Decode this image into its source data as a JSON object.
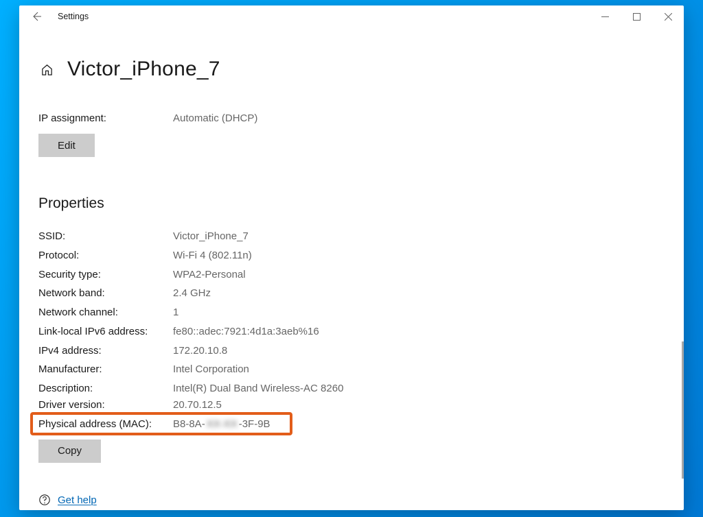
{
  "window": {
    "title": "Settings"
  },
  "header": {
    "page_title": "Victor_iPhone_7"
  },
  "ip_assignment": {
    "label": "IP assignment:",
    "value": "Automatic (DHCP)",
    "button": "Edit"
  },
  "properties": {
    "heading": "Properties",
    "rows": [
      {
        "label": "SSID:",
        "value": "Victor_iPhone_7"
      },
      {
        "label": "Protocol:",
        "value": "Wi-Fi 4 (802.11n)"
      },
      {
        "label": "Security type:",
        "value": "WPA2-Personal"
      },
      {
        "label": "Network band:",
        "value": "2.4 GHz"
      },
      {
        "label": "Network channel:",
        "value": "1"
      },
      {
        "label": "Link-local IPv6 address:",
        "value": "fe80::adec:7921:4d1a:3aeb%16"
      },
      {
        "label": "IPv4 address:",
        "value": "172.20.10.8"
      },
      {
        "label": "Manufacturer:",
        "value": "Intel Corporation"
      },
      {
        "label": "Description:",
        "value": "Intel(R) Dual Band Wireless-AC 8260"
      },
      {
        "label": "Driver version:",
        "value": "20.70.12.5"
      }
    ],
    "mac_row": {
      "label": "Physical address (MAC):",
      "prefix": "B8-8A-",
      "blurred": "XX-XX",
      "suffix": "-3F-9B"
    },
    "copy_button": "Copy"
  },
  "help": {
    "text": "Get help"
  }
}
